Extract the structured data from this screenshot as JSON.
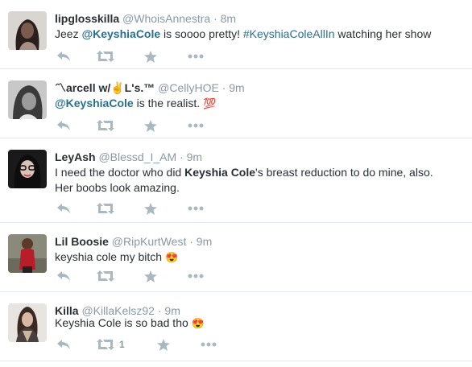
{
  "tweets": [
    {
      "name": "lipglosskilla",
      "handle": "@WhoisAnnestra",
      "sep": "·",
      "time": "8m",
      "text_parts": [
        "Jeez ",
        "@KeyshiaCole",
        " is soooo pretty! ",
        "#KeyshiaColeAllIn",
        " watching her show"
      ],
      "retweets": ""
    },
    {
      "name": "〽arcell w/✌L's.™",
      "handle": "@CellyHOE",
      "sep": "·",
      "time": "9m",
      "text_parts": [
        "@KeyshiaCole",
        " is the realist. ",
        "💯"
      ],
      "retweets": ""
    },
    {
      "name": "LeyAsh",
      "handle": "@Blessd_I_AM",
      "sep": "·",
      "time": "9m",
      "text_parts": [
        "I need the doctor who did ",
        "Keyshia Cole",
        "'s breast reduction to do mine, also.",
        "Her boobs look amazing."
      ],
      "retweets": ""
    },
    {
      "name": "Lil Boosie",
      "handle": "@RipKurtWest",
      "sep": "·",
      "time": "9m",
      "text_parts": [
        "keyshia cole my bitch ",
        "😍"
      ],
      "retweets": ""
    },
    {
      "name": "Killa",
      "handle": "@KillaKelsz92",
      "sep": "·",
      "time": "9m",
      "text_parts": [
        "Keyshia Cole is so bad tho ",
        "😍"
      ],
      "retweets": "1"
    }
  ],
  "icons": [
    "reply-icon",
    "retweet-icon",
    "favorite-icon",
    "more-icon"
  ],
  "colors": {
    "link": "#2a6f90",
    "muted": "#8899a6",
    "divider": "#e1e8ed"
  }
}
